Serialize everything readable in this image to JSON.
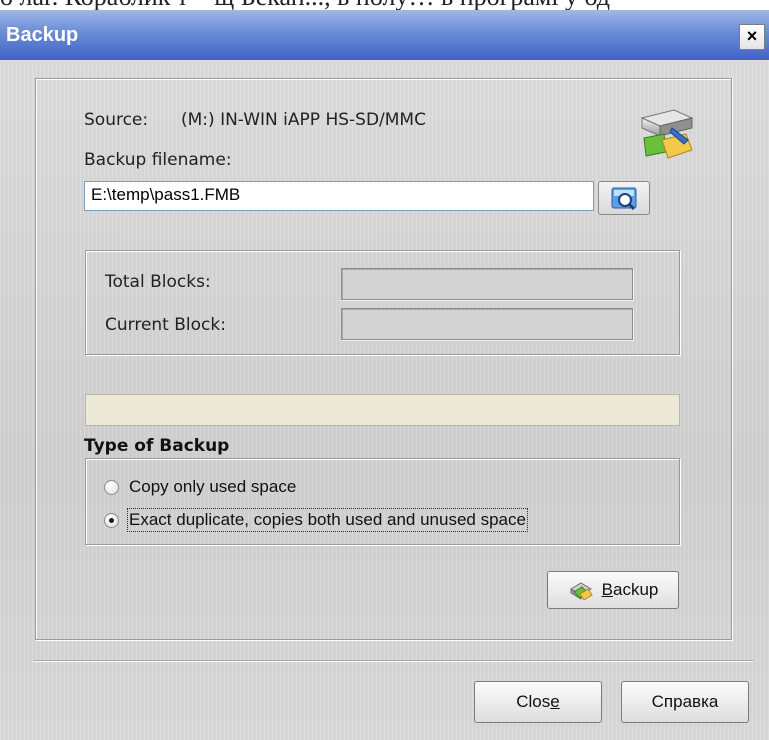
{
  "background_text": "о  лаг. Кораблик т – щ Бекап..., в полу… в програмі у од",
  "window": {
    "title": "Backup",
    "close_glyph": "×"
  },
  "source": {
    "label": "Source:",
    "value": "(M:) IN-WIN  iAPP  HS-SD/MMC"
  },
  "backup_filename": {
    "label": "Backup filename:",
    "value": "E:\\temp\\pass1.FMB"
  },
  "blocks": {
    "total_label": "Total Blocks:",
    "current_label": "Current Block:",
    "total_value": "",
    "current_value": ""
  },
  "progress": {
    "fraction": 0
  },
  "type_of_backup": {
    "title": "Type of Backup",
    "options": [
      {
        "label": "Copy only used space",
        "checked": false
      },
      {
        "label": "Exact duplicate, copies both used and unused space",
        "checked": true
      }
    ]
  },
  "buttons": {
    "backup_mnemonic": "B",
    "backup_rest": "ackup",
    "close_prefix": "Clos",
    "close_mnemonic": "e",
    "help": "Справка"
  },
  "icons": {
    "drive": "drive-backup-icon",
    "browse": "browse-search-icon",
    "backup": "backup-tools-icon"
  }
}
